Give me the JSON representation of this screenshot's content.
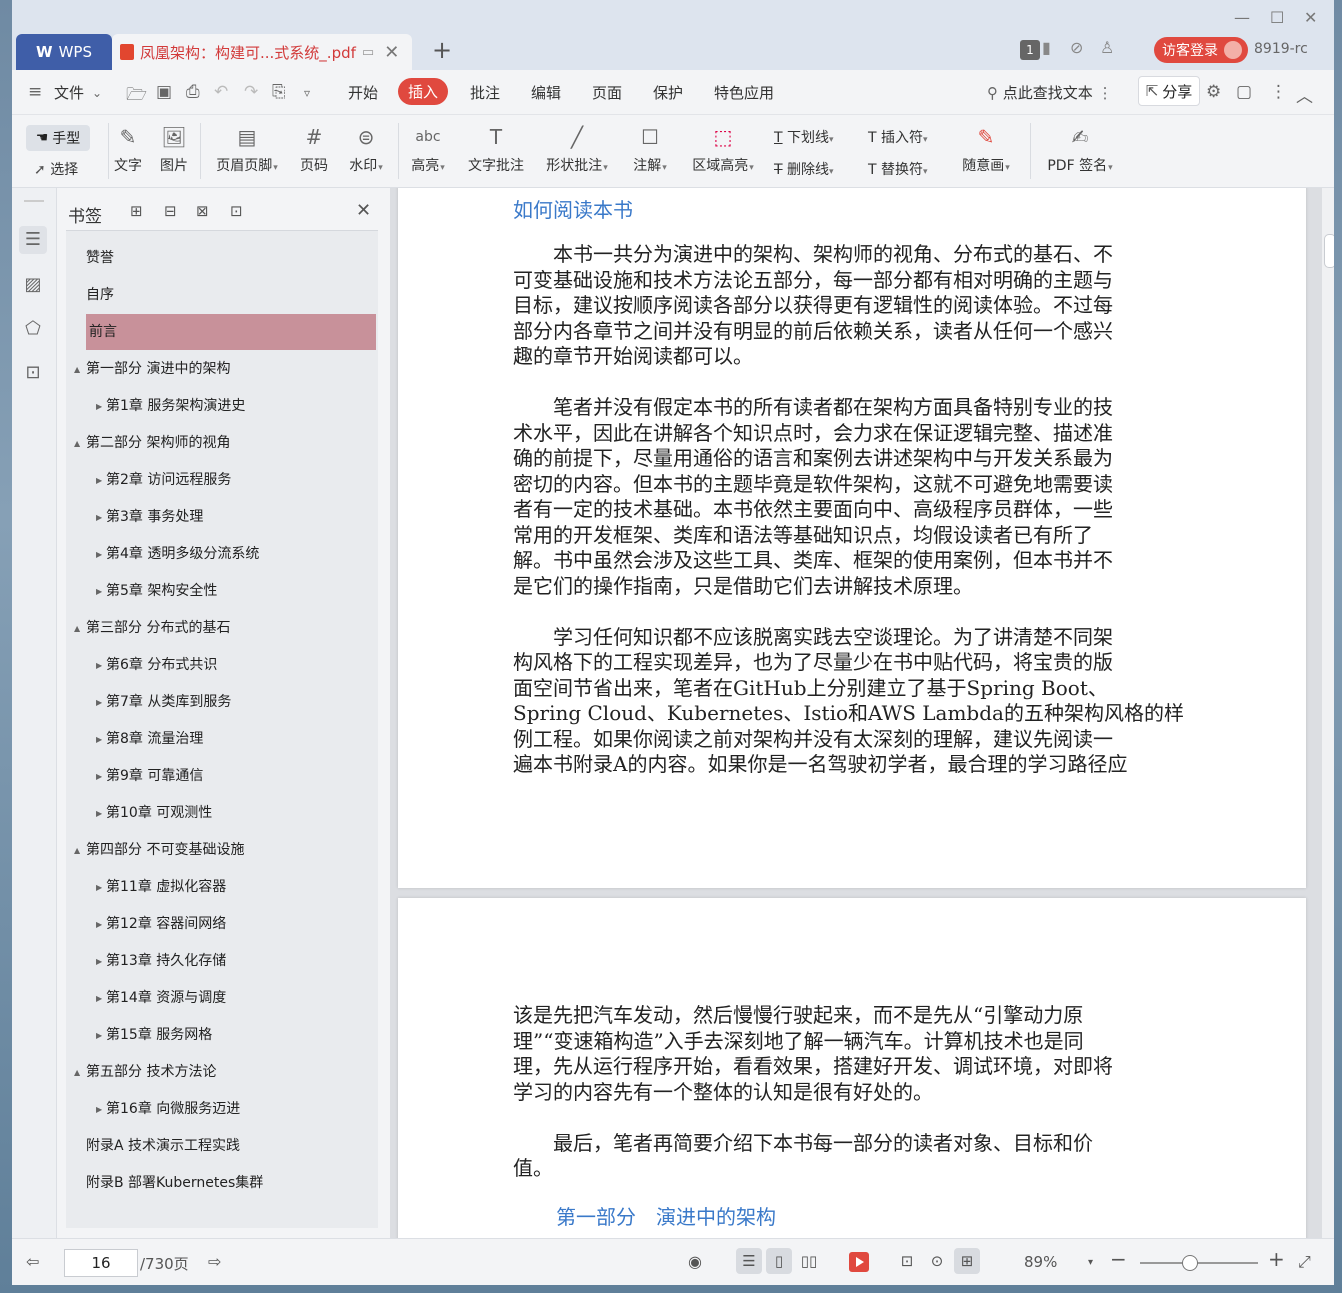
{
  "titlebar": {
    "app_tab": "WPS",
    "doc_tab": "凤凰架构：构建可...式系统_.pdf",
    "badge": "1",
    "login": "访客登录",
    "user": "8919-rc"
  },
  "menu": {
    "file": "文件",
    "tabs": [
      "开始",
      "插入",
      "批注",
      "编辑",
      "页面",
      "保护",
      "特色应用"
    ],
    "active_tab": "插入",
    "search": "点此查找文本",
    "share": "分享"
  },
  "toolbar": {
    "hand": "手型",
    "select": "选择",
    "text": "文字",
    "image": "图片",
    "header_footer": "页眉页脚",
    "page_number": "页码",
    "watermark": "水印",
    "highlight": "高亮",
    "text_comment": "文字批注",
    "shape_comment": "形状批注",
    "annotation": "注解",
    "area_highlight": "区域高亮",
    "underline": "下划线",
    "strikethrough": "删除线",
    "insert_mark": "插入符",
    "replace_mark": "替换符",
    "freehand": "随意画",
    "pdf_sign": "PDF 签名"
  },
  "bookmarks": {
    "title": "书签",
    "items": [
      {
        "label": "赞誉",
        "level": 1
      },
      {
        "label": "自序",
        "level": 1
      },
      {
        "label": "前言",
        "level": 1,
        "selected": true
      },
      {
        "label": "第一部分 演进中的架构",
        "level": 1
      },
      {
        "label": "第1章 服务架构演进史",
        "level": 2
      },
      {
        "label": "第二部分 架构师的视角",
        "level": 1
      },
      {
        "label": "第2章 访问远程服务",
        "level": 2
      },
      {
        "label": "第3章 事务处理",
        "level": 2
      },
      {
        "label": "第4章 透明多级分流系统",
        "level": 2
      },
      {
        "label": "第5章 架构安全性",
        "level": 2
      },
      {
        "label": "第三部分 分布式的基石",
        "level": 1
      },
      {
        "label": "第6章 分布式共识",
        "level": 2
      },
      {
        "label": "第7章 从类库到服务",
        "level": 2
      },
      {
        "label": "第8章 流量治理",
        "level": 2
      },
      {
        "label": "第9章 可靠通信",
        "level": 2
      },
      {
        "label": "第10章 可观测性",
        "level": 2
      },
      {
        "label": "第四部分 不可变基础设施",
        "level": 1
      },
      {
        "label": "第11章 虚拟化容器",
        "level": 2
      },
      {
        "label": "第12章 容器间网络",
        "level": 2
      },
      {
        "label": "第13章 持久化存储",
        "level": 2
      },
      {
        "label": "第14章 资源与调度",
        "level": 2
      },
      {
        "label": "第15章 服务网格",
        "level": 2
      },
      {
        "label": "第五部分 技术方法论",
        "level": 1
      },
      {
        "label": "第16章 向微服务迈进",
        "level": 2
      },
      {
        "label": "附录A 技术演示工程实践",
        "level": 1
      },
      {
        "label": "附录B 部署Kubernetes集群",
        "level": 1
      }
    ]
  },
  "document": {
    "page1_heading": "如何阅读本书",
    "page1_lines": [
      "　　本书一共分为演进中的架构、架构师的视角、分布式的基石、不",
      "可变基础设施和技术方法论五部分，每一部分都有相对明确的主题与",
      "目标，建议按顺序阅读各部分以获得更有逻辑性的阅读体验。不过每",
      "部分内各章节之间并没有明显的前后依赖关系，读者从任何一个感兴",
      "趣的章节开始阅读都可以。",
      "",
      "　　笔者并没有假定本书的所有读者都在架构方面具备特别专业的技",
      "术水平，因此在讲解各个知识点时，会力求在保证逻辑完整、描述准",
      "确的前提下，尽量用通俗的语言和案例去讲述架构中与开发关系最为",
      "密切的内容。但本书的主题毕竟是软件架构，这就不可避免地需要读",
      "者有一定的技术基础。本书依然主要面向中、高级程序员群体，一些",
      "常用的开发框架、类库和语法等基础知识点，均假设读者已有所了",
      "解。书中虽然会涉及这些工具、类库、框架的使用案例，但本书并不",
      "是它们的操作指南，只是借助它们去讲解技术原理。",
      "",
      "　　学习任何知识都不应该脱离实践去空谈理论。为了讲清楚不同架",
      "构风格下的工程实现差异，也为了尽量少在书中贴代码，将宝贵的版",
      "面空间节省出来，笔者在GitHub上分别建立了基于Spring Boot、",
      "Spring Cloud、Kubernetes、Istio和AWS Lambda的五种架构风格的样",
      "例工程。如果你阅读之前对架构并没有太深刻的理解，建议先阅读一",
      "遍本书附录A的内容。如果你是一名驾驶初学者，最合理的学习路径应"
    ],
    "page2_lines": [
      "该是先把汽车发动，然后慢慢行驶起来，而不是先从“引擎动力原",
      "理”“变速箱构造”入手去深刻地了解一辆汽车。计算机技术也是同",
      "理，先从运行程序开始，看看效果，搭建好开发、调试环境，对即将",
      "学习的内容先有一个整体的认知是很有好处的。",
      "",
      "　　最后，笔者再简要介绍下本书每一部分的读者对象、目标和价",
      "值。"
    ],
    "page2_heading": "第一部分　演进中的架构"
  },
  "status": {
    "current_page": "16",
    "total_pages": "/730页",
    "zoom": "89%"
  }
}
